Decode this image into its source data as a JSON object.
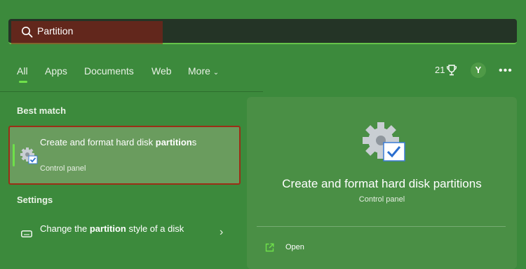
{
  "search": {
    "query": "Partition"
  },
  "tabs": [
    {
      "label": "All"
    },
    {
      "label": "Apps"
    },
    {
      "label": "Documents"
    },
    {
      "label": "Web"
    },
    {
      "label": "More"
    }
  ],
  "header": {
    "rewards_points": "21",
    "avatar_initial": "Y",
    "more_options": "•••"
  },
  "results": {
    "best_match_label": "Best match",
    "best_match": {
      "title_before": "Create and format hard disk ",
      "title_bold": "partition",
      "title_after": "s",
      "subtitle": "Control panel",
      "icon": "gear-check-icon"
    },
    "settings_label": "Settings",
    "settings_item": {
      "text_before": "Change the ",
      "text_bold": "partition",
      "text_after": " style of a disk",
      "icon": "drive-icon"
    }
  },
  "preview": {
    "title": "Create and format hard disk partitions",
    "subtitle": "Control panel",
    "icon": "gear-check-icon",
    "actions": [
      {
        "label": "Open",
        "icon": "open-external-icon"
      }
    ]
  },
  "colors": {
    "accent": "#6fe04a",
    "highlight_border": "#9b2e16"
  }
}
